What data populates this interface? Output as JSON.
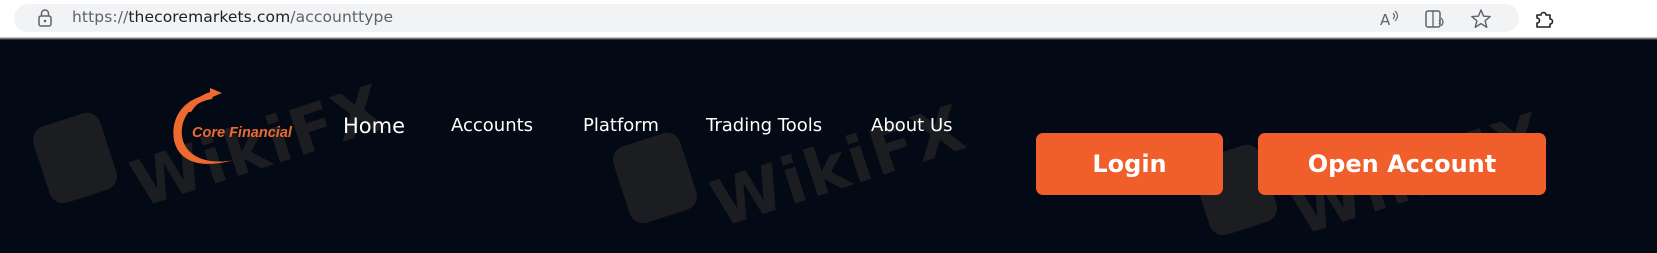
{
  "browser": {
    "url_scheme": "https://",
    "url_host": "thecoremarkets.com",
    "url_path": "/accounttype",
    "icons": [
      "lock-icon",
      "read-aloud-icon",
      "immersive-reader-icon",
      "favorite-star-icon",
      "extensions-icon"
    ]
  },
  "site": {
    "logo_text": "Core Financial",
    "nav": {
      "home": "Home",
      "accounts": "Accounts",
      "platform": "Platform",
      "trading_tools": "Trading Tools",
      "about_us": "About Us"
    },
    "login_label": "Login",
    "open_account_label": "Open Account",
    "watermark": "WikiFX"
  },
  "colors": {
    "background": "#030915",
    "accent": "#ef5e2b",
    "logo": "#ee6a2f"
  }
}
